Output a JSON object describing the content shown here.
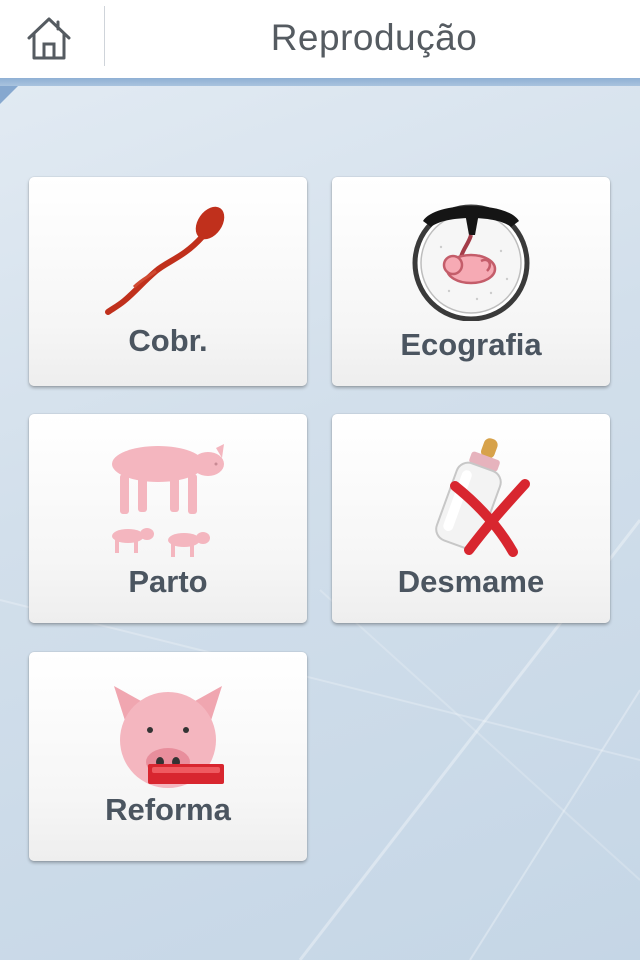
{
  "header": {
    "title": "Reprodução",
    "home_icon": "home-icon"
  },
  "menu": [
    {
      "id": "cobr",
      "label": "Cobr.",
      "icon": "sperm-icon"
    },
    {
      "id": "ecografia",
      "label": "Ecografia",
      "icon": "ultrasound-fetus-icon"
    },
    {
      "id": "parto",
      "label": "Parto",
      "icon": "sow-piglets-icon"
    },
    {
      "id": "desmame",
      "label": "Desmame",
      "icon": "bottle-cross-icon"
    },
    {
      "id": "reforma",
      "label": "Reforma",
      "icon": "pig-minus-icon"
    }
  ],
  "colors": {
    "title_text": "#555b61",
    "label_text": "#4b5560",
    "accent_band": "#9dbbdb",
    "pig_pink": "#f4b6bf",
    "red": "#d8262f"
  }
}
